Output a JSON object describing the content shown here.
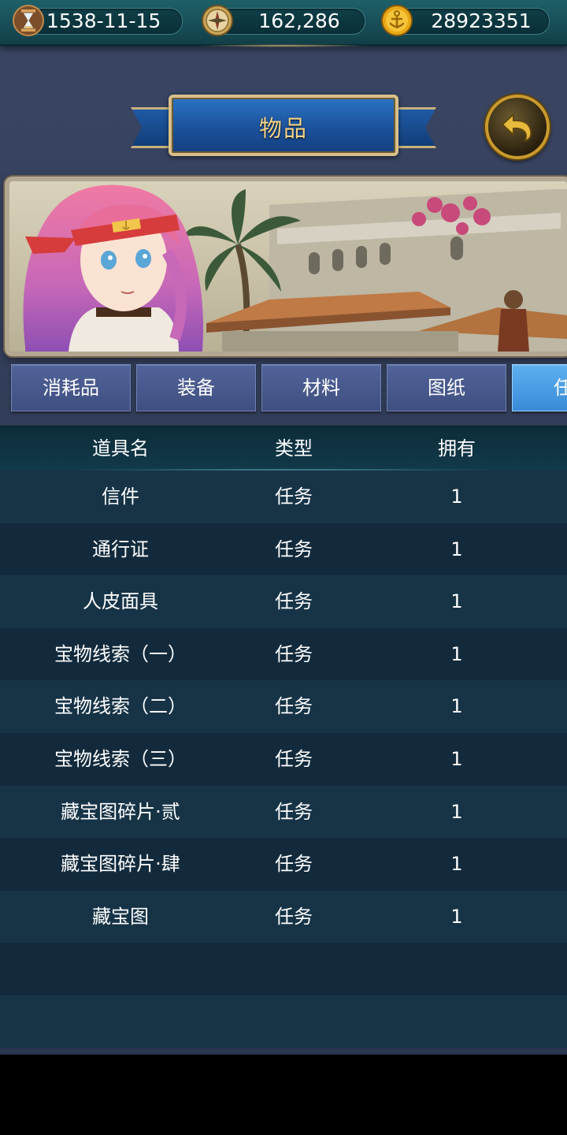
{
  "status_bar": {
    "date": "1538-11-15",
    "compass_value": "162,286",
    "gold_value": "28923351",
    "icons": [
      "hourglass-icon",
      "compass-icon",
      "anchor-coin-icon"
    ]
  },
  "banner": {
    "title": "物品"
  },
  "back_button": {
    "icon": "back-arrow-icon"
  },
  "tabs": [
    {
      "label": "消耗品"
    },
    {
      "label": "装备"
    },
    {
      "label": "材料"
    },
    {
      "label": "图纸"
    },
    {
      "label": "任"
    }
  ],
  "table": {
    "headers": {
      "name": "道具名",
      "type": "类型",
      "owned": "拥有"
    },
    "rows": [
      {
        "name": "信件",
        "type": "任务",
        "owned": "1"
      },
      {
        "name": "通行证",
        "type": "任务",
        "owned": "1"
      },
      {
        "name": "人皮面具",
        "type": "任务",
        "owned": "1"
      },
      {
        "name": "宝物线索（一）",
        "type": "任务",
        "owned": "1"
      },
      {
        "name": "宝物线索（二）",
        "type": "任务",
        "owned": "1"
      },
      {
        "name": "宝物线索（三）",
        "type": "任务",
        "owned": "1"
      },
      {
        "name": "藏宝图碎片·贰",
        "type": "任务",
        "owned": "1"
      },
      {
        "name": "藏宝图碎片·肆",
        "type": "任务",
        "owned": "1"
      },
      {
        "name": "藏宝图",
        "type": "任务",
        "owned": "1"
      }
    ]
  },
  "colors": {
    "tab_active": "#3a8ad8",
    "tab_inactive": "#46568a",
    "title_text": "#f3d58a",
    "gold": "#c99a2e"
  }
}
